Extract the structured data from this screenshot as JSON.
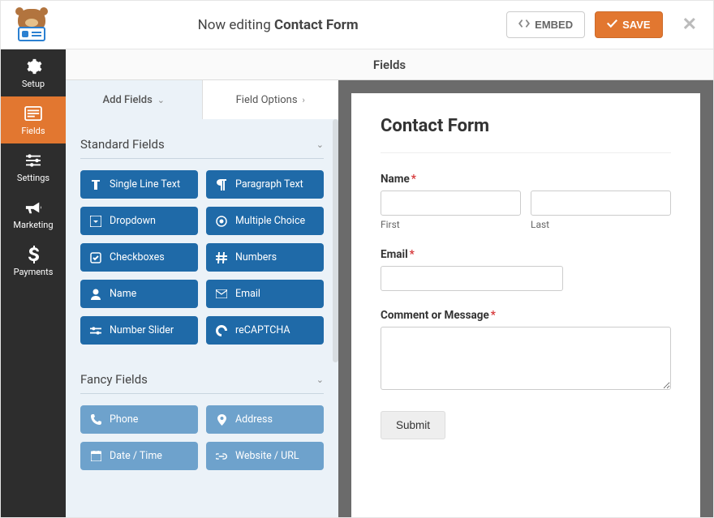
{
  "header": {
    "editing_prefix": "Now editing ",
    "form_name": "Contact Form",
    "embed_label": "EMBED",
    "save_label": "SAVE"
  },
  "sidebar": {
    "items": [
      {
        "id": "setup",
        "label": "Setup",
        "icon": "gear-icon",
        "active": false
      },
      {
        "id": "fields",
        "label": "Fields",
        "icon": "form-icon",
        "active": true
      },
      {
        "id": "settings",
        "label": "Settings",
        "icon": "sliders-icon",
        "active": false
      },
      {
        "id": "marketing",
        "label": "Marketing",
        "icon": "bullhorn-icon",
        "active": false
      },
      {
        "id": "payments",
        "label": "Payments",
        "icon": "dollar-icon",
        "active": false
      }
    ]
  },
  "content_title": "Fields",
  "panel": {
    "tabs": {
      "add_fields": "Add Fields",
      "field_options": "Field Options"
    },
    "sections": {
      "standard": {
        "title": "Standard Fields",
        "fields": [
          {
            "label": "Single Line Text",
            "icon": "text-icon"
          },
          {
            "label": "Paragraph Text",
            "icon": "paragraph-icon"
          },
          {
            "label": "Dropdown",
            "icon": "dropdown-icon"
          },
          {
            "label": "Multiple Choice",
            "icon": "radio-icon"
          },
          {
            "label": "Checkboxes",
            "icon": "checkbox-icon"
          },
          {
            "label": "Numbers",
            "icon": "hash-icon"
          },
          {
            "label": "Name",
            "icon": "user-icon"
          },
          {
            "label": "Email",
            "icon": "envelope-icon"
          },
          {
            "label": "Number Slider",
            "icon": "slider-icon"
          },
          {
            "label": "reCAPTCHA",
            "icon": "recaptcha-icon"
          }
        ]
      },
      "fancy": {
        "title": "Fancy Fields",
        "fields": [
          {
            "label": "Phone",
            "icon": "phone-icon"
          },
          {
            "label": "Address",
            "icon": "pin-icon"
          },
          {
            "label": "Date / Time",
            "icon": "calendar-icon"
          },
          {
            "label": "Website / URL",
            "icon": "link-icon"
          }
        ]
      }
    }
  },
  "preview": {
    "title": "Contact Form",
    "name_label": "Name",
    "first_label": "First",
    "last_label": "Last",
    "email_label": "Email",
    "message_label": "Comment or Message",
    "submit_label": "Submit",
    "required_mark": "*"
  }
}
